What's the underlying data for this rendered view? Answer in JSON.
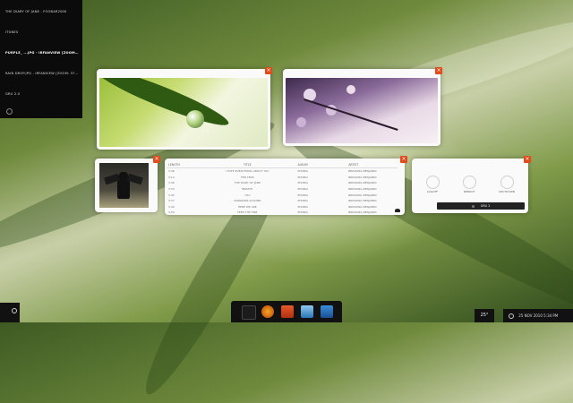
{
  "switcher": {
    "items": [
      {
        "label": "THE DIARY OF JANE - FOOBAR2000"
      },
      {
        "label": "ITUNES"
      },
      {
        "label": "PURPLE_ ...JPG - IRFANVIEW [ZOOM: 418 X...",
        "active": true
      },
      {
        "label": "RAIN DROP.JPG - IRFANVIEW [ZOOM: 378 X..."
      },
      {
        "label": "GRU 2.0"
      }
    ],
    "settings_icon": "gear-icon"
  },
  "windows": {
    "close_glyph": "×",
    "raindrop": {
      "image": "green-leaf-raindrop-photo"
    },
    "purple": {
      "image": "purple-blossom-photo"
    },
    "album": {
      "image": "album-cover-art"
    }
  },
  "music": {
    "columns": [
      "LENGTH",
      "TITLE",
      "ALBUM",
      "ARTIST"
    ],
    "rows": [
      [
        "3:48",
        "I HATE EVERYTHING ABOUT YOU",
        "PHOBIA",
        "BREAKING BENJAMIN"
      ],
      [
        "3:14",
        "TEN TENS",
        "PHOBIA",
        "BREAKING BENJAMIN"
      ],
      [
        "3:38",
        "THE DIARY OF JANE",
        "PHOBIA",
        "BREAKING BENJAMIN"
      ],
      [
        "3:33",
        "BREATH",
        "PHOBIA",
        "BREAKING BENJAMIN"
      ],
      [
        "3:45",
        "YOU",
        "PHOBIA",
        "BREAKING BENJAMIN"
      ],
      [
        "3:37",
        "UNKNOWN SOLDIER",
        "PHOBIA",
        "BREAKING BENJAMIN"
      ],
      [
        "3:40",
        "HERE WE ARE",
        "PHOBIA",
        "BREAKING BENJAMIN"
      ],
      [
        "3:50",
        "FEED THE FIRE",
        "PHOBIA",
        "BREAKING BENJAMIN"
      ]
    ],
    "logo_icon": "batman-logo-icon"
  },
  "power_panel": {
    "buttons": [
      {
        "label": "LOGOFF",
        "icon": "logoff-icon"
      },
      {
        "label": "REBOOT",
        "icon": "reboot-icon"
      },
      {
        "label": "SHUTDOWN",
        "icon": "shutdown-icon"
      }
    ],
    "footer_label": "GRU 2"
  },
  "taskbar": {
    "temperature": "25°",
    "clock": "25 NOV 2010  5:34 PM",
    "dock_icons": [
      "foobar-icon",
      "itunes-icon",
      "irfanview-icon",
      "finder-icon",
      "desktop-icon"
    ]
  },
  "colors": {
    "accent_red": "#e24b1c",
    "panel_dark": "#0b0b0b"
  }
}
